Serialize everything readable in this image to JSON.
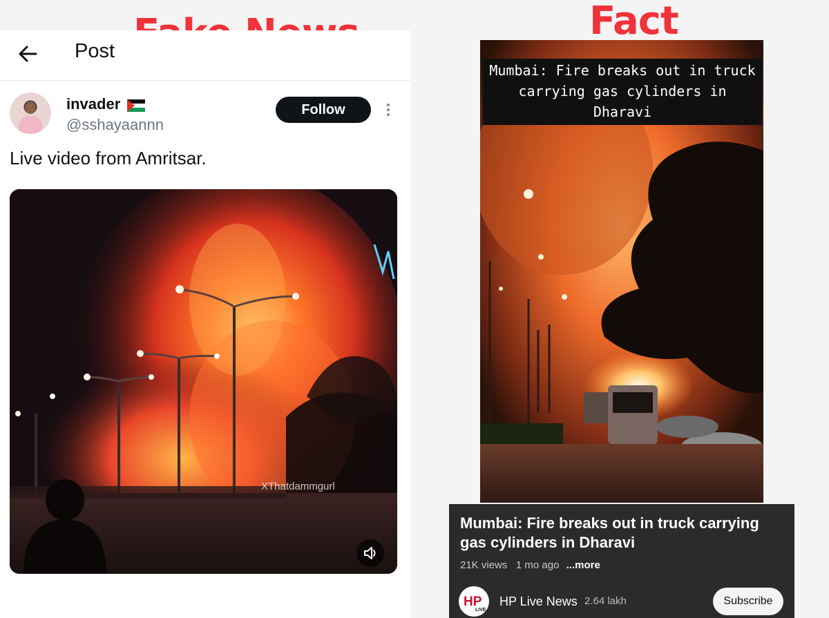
{
  "labels": {
    "fake": "Fake News",
    "fact": "Fact"
  },
  "left_post": {
    "header_title": "Post",
    "display_name": "invader",
    "handle": "@sshayaannn",
    "follow_label": "Follow",
    "text": "Live video from Amritsar.",
    "video_watermark": "XThatdammgurl",
    "icons": [
      "back-arrow-icon",
      "palestine-flag-icon",
      "more-icon",
      "volume-icon"
    ]
  },
  "right_video": {
    "overlay_caption": "Mumbai: Fire breaks out in truck carrying gas cylinders in Dharavi",
    "title": "Mumbai: Fire breaks out in truck carrying gas cylinders in Dharavi",
    "views": "21K views",
    "age": "1 mo ago",
    "more_label": "...more",
    "channel_name": "HP Live News",
    "subscribers": "2.64 lakh",
    "subscribe_label": "Subscribe",
    "channel_logo_text": "HP",
    "channel_logo_subtext": "LIVE"
  },
  "colors": {
    "label_red": "#f0323a",
    "follow_bg": "#0f1419",
    "card_bg": "#2b2b2b"
  }
}
